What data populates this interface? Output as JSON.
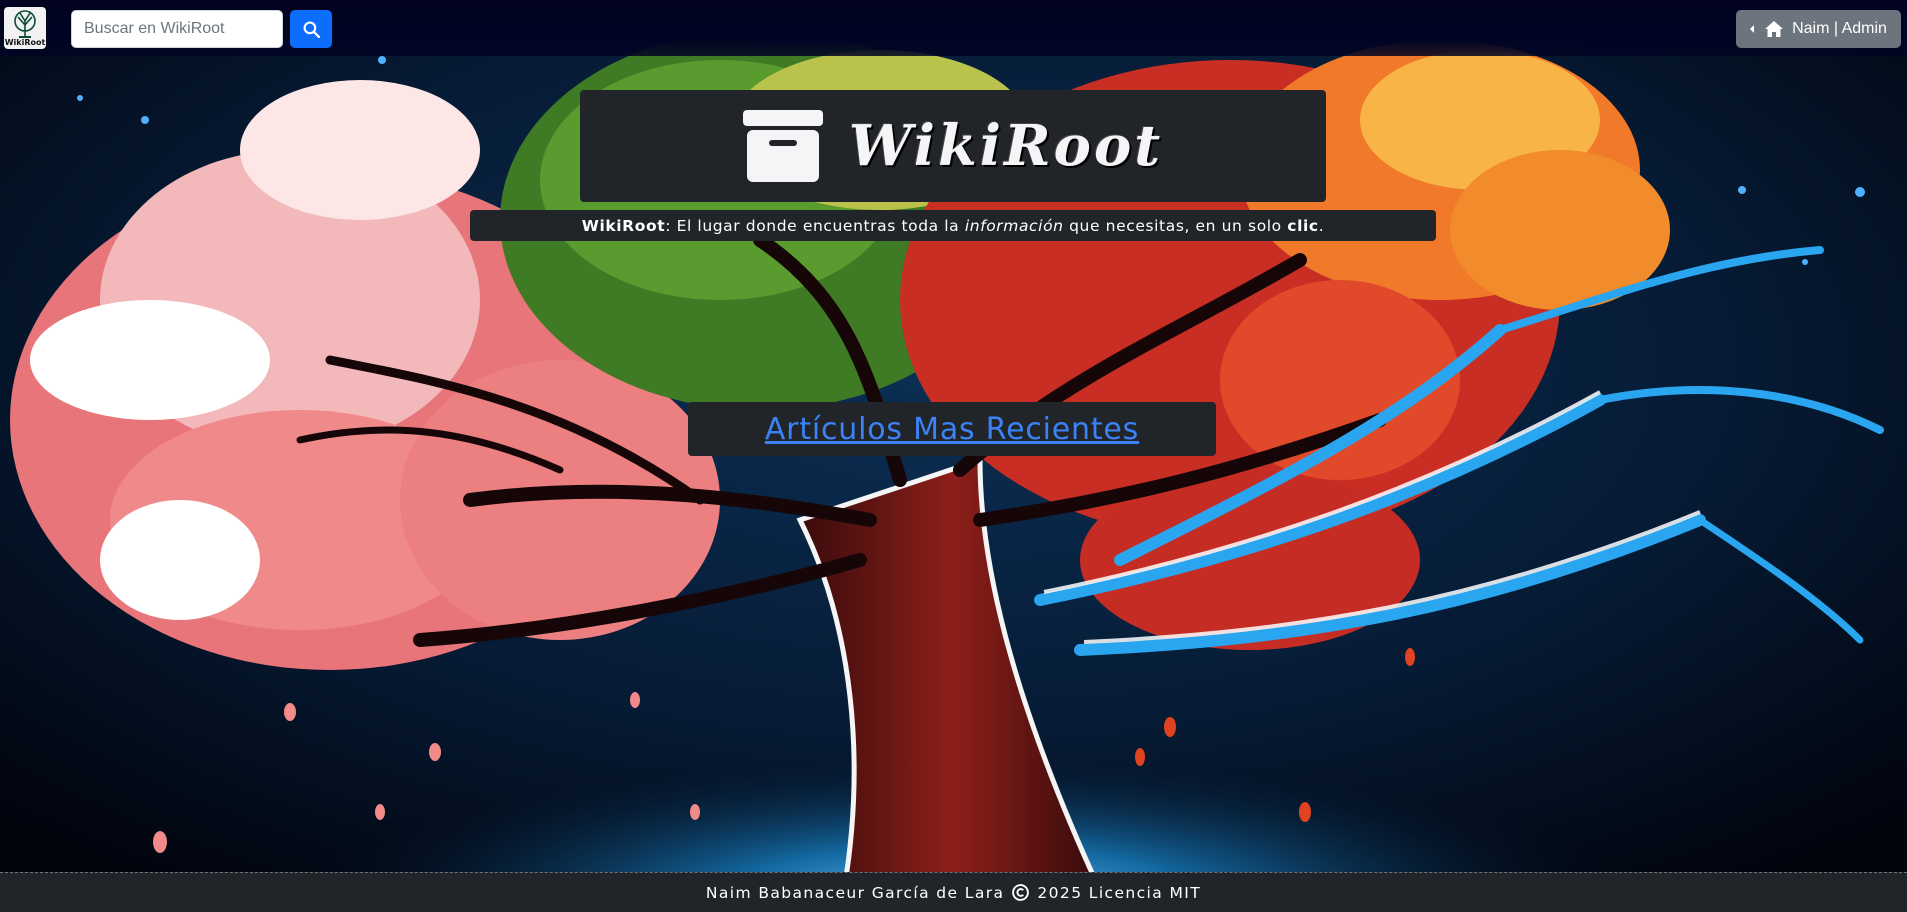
{
  "navbar": {
    "logo": {
      "text": "WikiRoot",
      "icon": "tree-icon"
    },
    "search": {
      "placeholder": "Buscar en WikiRoot",
      "value": "",
      "button_icon": "search-icon"
    },
    "user_menu": {
      "label": "Naim | Admin",
      "icon": "home-icon",
      "caret_icon": "caret-left-icon"
    }
  },
  "hero": {
    "brand_title": "WikiRoot",
    "brand_icon": "archive-box-icon",
    "tagline": {
      "brand": "WikiRoot",
      "part1": ": El lugar donde encuentras toda la ",
      "emphasis": "información",
      "part2": " que necesitas, en un solo ",
      "strong": "clic",
      "end": "."
    },
    "recent_link": "Artículos Mas Recientes"
  },
  "footer": {
    "author": "Naim Babanaceur García de Lara",
    "copyright_icon": "copyright-icon",
    "license": "2025 Licencia MIT"
  },
  "colors": {
    "navbar_bg": "#010423",
    "panel_bg": "#212529",
    "primary": "#0d6efd",
    "secondary": "#6c757d",
    "link": "#3b82f6"
  }
}
